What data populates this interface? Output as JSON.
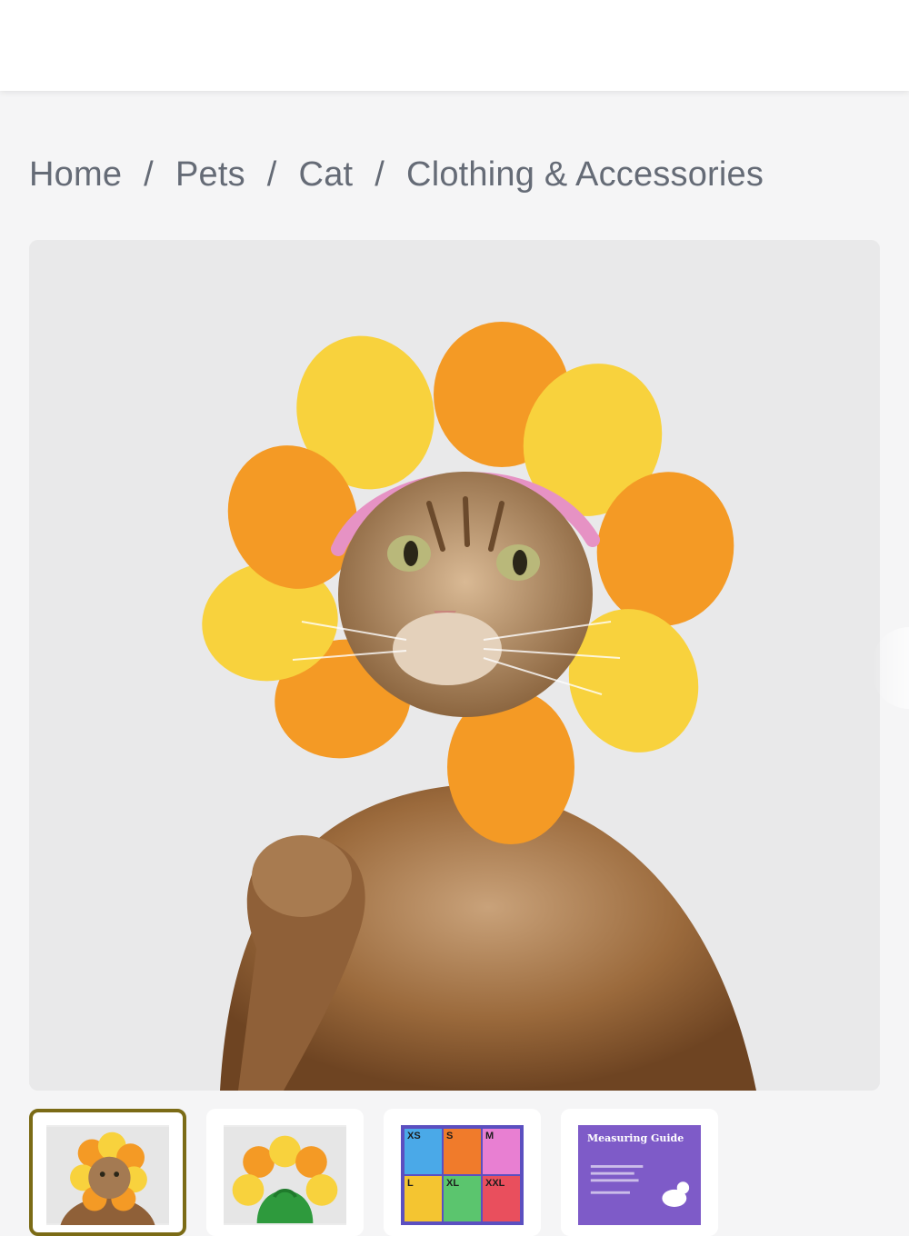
{
  "breadcrumb": {
    "items": [
      "Home",
      "Pets",
      "Cat",
      "Clothing & Accessories"
    ],
    "separator": "/"
  },
  "hero_image": {
    "alt": "cat wearing flower petal hat",
    "icon": "product-photo"
  },
  "thumbnails": {
    "selected_index": 0,
    "size_chart": {
      "cells": [
        "XS",
        "S",
        "M",
        "L",
        "XL",
        "XXL"
      ],
      "colors": [
        "#4aa9e8",
        "#f07b2b",
        "#e87fd2",
        "#f4c531",
        "#5bc56e",
        "#e94f5d"
      ]
    },
    "guide_title": "Measuring Guide"
  },
  "colors": {
    "page_bg": "#f5f5f6",
    "selected_border": "#7b6b16",
    "petal_yellow": "#f8d23d",
    "petal_orange": "#f49a25"
  }
}
